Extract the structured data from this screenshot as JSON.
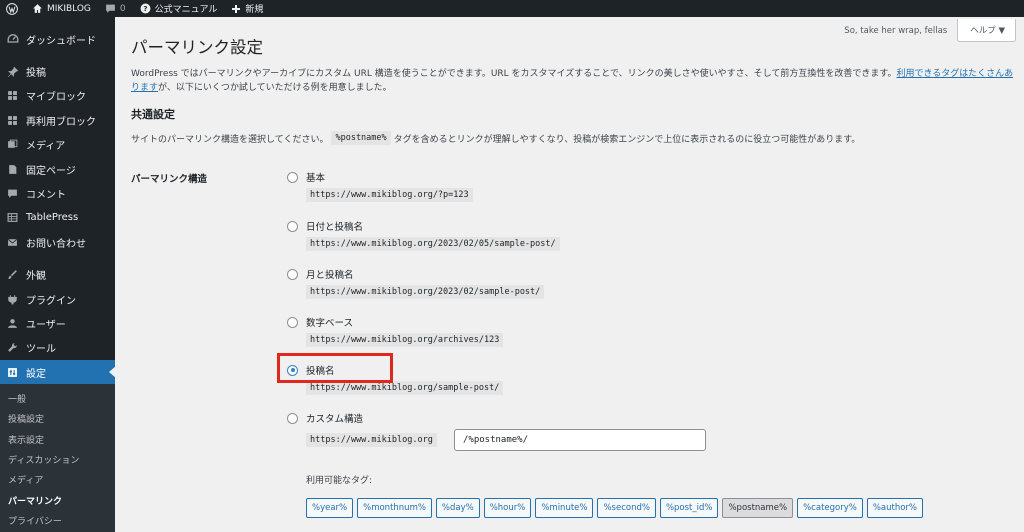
{
  "adminbar": {
    "site_name": "MIKIBLOG",
    "comments_count": "0",
    "manual": "公式マニュアル",
    "new": "新規"
  },
  "sidebar": {
    "items": [
      {
        "label": "ダッシュボード",
        "icon": "dashboard-icon"
      },
      {
        "label": "投稿",
        "icon": "pin-icon"
      },
      {
        "label": "マイブロック",
        "icon": "blocks-icon"
      },
      {
        "label": "再利用ブロック",
        "icon": "blocks-icon"
      },
      {
        "label": "メディア",
        "icon": "media-icon"
      },
      {
        "label": "固定ページ",
        "icon": "page-icon"
      },
      {
        "label": "コメント",
        "icon": "comment-icon"
      },
      {
        "label": "TablePress",
        "icon": "table-icon"
      },
      {
        "label": "お問い合わせ",
        "icon": "mail-icon"
      },
      {
        "label": "外観",
        "icon": "brush-icon"
      },
      {
        "label": "プラグイン",
        "icon": "plugin-icon"
      },
      {
        "label": "ユーザー",
        "icon": "user-icon"
      },
      {
        "label": "ツール",
        "icon": "wrench-icon"
      },
      {
        "label": "設定",
        "icon": "settings-icon"
      }
    ],
    "submenu": [
      "一般",
      "投稿設定",
      "表示設定",
      "ディスカッション",
      "メディア",
      "パーマリンク",
      "プライバシー"
    ]
  },
  "header": {
    "greeting": "So, take her wrap, fellas",
    "help": "ヘルプ ▼"
  },
  "main": {
    "title": "パーマリンク設定",
    "intro_text": "WordPress ではパーマリンクやアーカイブにカスタム URL 構造を使うことができます。URL をカスタマイズすることで、リンクの美しさや使いやすさ、そして前方互換性を改善できます。",
    "intro_link": "利用できるタグはたくさんあります",
    "intro_tail": "が、以下にいくつか試していただける例を用意しました。",
    "section_title": "共通設定",
    "section_desc_before": "サイトのパーマリンク構造を選択してください。",
    "section_desc_code": "%postname%",
    "section_desc_after": "タグを含めるとリンクが理解しやすくなり、投稿が検索エンジンで上位に表示されるのに役立つ可能性があります。",
    "structure_label": "パーマリンク構造",
    "options": [
      {
        "label": "基本",
        "example": "https://www.mikiblog.org/?p=123",
        "checked": false
      },
      {
        "label": "日付と投稿名",
        "example": "https://www.mikiblog.org/2023/02/05/sample-post/",
        "checked": false
      },
      {
        "label": "月と投稿名",
        "example": "https://www.mikiblog.org/2023/02/sample-post/",
        "checked": false
      },
      {
        "label": "数字ベース",
        "example": "https://www.mikiblog.org/archives/123",
        "checked": false
      },
      {
        "label": "投稿名",
        "example": "https://www.mikiblog.org/sample-post/",
        "checked": true
      },
      {
        "label": "カスタム構造",
        "example": "https://www.mikiblog.org",
        "checked": false
      }
    ],
    "custom_value": "/%postname%/",
    "available_tags_label": "利用可能なタグ:",
    "tags": [
      "%year%",
      "%monthnum%",
      "%day%",
      "%hour%",
      "%minute%",
      "%second%",
      "%post_id%",
      "%postname%",
      "%category%",
      "%author%"
    ],
    "pressed_tag": "%postname%",
    "highlight_color": "#e1261c",
    "accent_color": "#2271b1"
  }
}
